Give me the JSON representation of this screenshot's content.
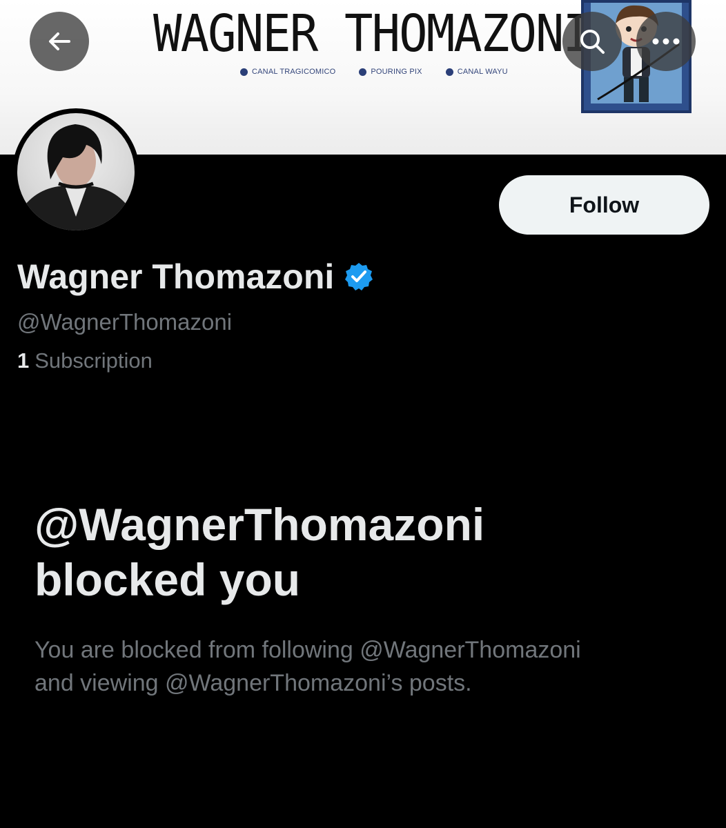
{
  "banner": {
    "title": "WAGNER THOMAZONI",
    "channels": [
      "CANAL TRAGICOMICO",
      "POURING PIX",
      "CANAL WAYU"
    ]
  },
  "header": {
    "back_icon": "arrow-left-icon",
    "search_icon": "search-icon",
    "more_icon": "more-horizontal-icon"
  },
  "profile": {
    "display_name": "Wagner Thomazoni",
    "verified_icon": "verified-badge-icon",
    "handle": "@WagnerThomazoni",
    "subscription_count": "1",
    "subscription_label": "Subscription"
  },
  "actions": {
    "follow_label": "Follow"
  },
  "blocked": {
    "title_line1": "@WagnerThomazoni",
    "title_line2": "blocked you",
    "description_line1": "You are blocked from following @WagnerThomazoni",
    "description_line2": "and viewing @WagnerThomazoni’s posts."
  },
  "colors": {
    "background": "#000000",
    "primary_text": "#e7e9ea",
    "secondary_text": "#71767b",
    "verified_blue": "#1d9bf0",
    "follow_button_bg": "#eff3f4"
  }
}
